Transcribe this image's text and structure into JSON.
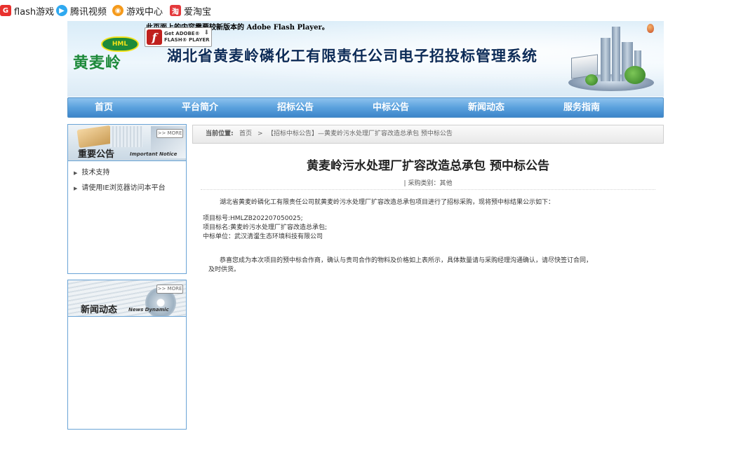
{
  "bookmarks": [
    {
      "label": "flash游戏",
      "icon": "flash-game-icon",
      "color": "#e8312e"
    },
    {
      "label": "腾讯视频",
      "icon": "tencent-video-icon",
      "color": "#2fa9f0"
    },
    {
      "label": "游戏中心",
      "icon": "game-center-icon",
      "color": "#f59a1b"
    },
    {
      "label": "爱淘宝",
      "icon": "taobao-icon",
      "color": "#e4393c"
    }
  ],
  "banner": {
    "flash_notice": "此页面上的内容需要较新版本的 Adobe Flash Player。",
    "flash_badge_line1": "Get ADOBE®",
    "flash_badge_line2": "FLASH® PLAYER",
    "logo_abbr": "HML",
    "logo_name": "黄麦岭",
    "site_title": "湖北省黄麦岭磷化工有限责任公司电子招投标管理系统"
  },
  "nav": [
    "首页",
    "平台简介",
    "招标公告",
    "中标公告",
    "新闻动态",
    "服务指南"
  ],
  "sidebar": {
    "notice": {
      "title": "重要公告",
      "title_en": "Important Notice",
      "more": ">> MORE",
      "items": [
        "技术支持",
        "请使用IE浏览器访问本平台"
      ]
    },
    "news": {
      "title": "新闻动态",
      "title_en": "News Dynamic",
      "more": ">> MORE"
    }
  },
  "breadcrumb": {
    "label": "当前位置:",
    "home": "首页",
    "sep": ">",
    "current": "【招标中标公告】—黄麦岭污水处理厂扩容改造总承包 预中标公告"
  },
  "article": {
    "title": "黄麦岭污水处理厂扩容改造总承包 预中标公告",
    "category": "| 采购类别：其他",
    "intro": "湖北省黄麦岭磷化工有限责任公司就黄麦岭污水处理厂扩容改造总承包项目进行了招标采购，现将预中标结果公示如下：",
    "bid_no": "项目标号:HMLZB202207050025;",
    "bid_name": "项目标名:黄麦岭污水处理厂扩容改造总承包;",
    "winner": "中标单位：武汉清瀣生态环境科技有限公司",
    "closing_1": "恭喜您成为本次项目的预中标合作商，确认与贵司合作的物料及价格如上表所示，具体数量请与采购经理沟通确认，请尽快签订合同，",
    "closing_2": "及时供货。"
  }
}
